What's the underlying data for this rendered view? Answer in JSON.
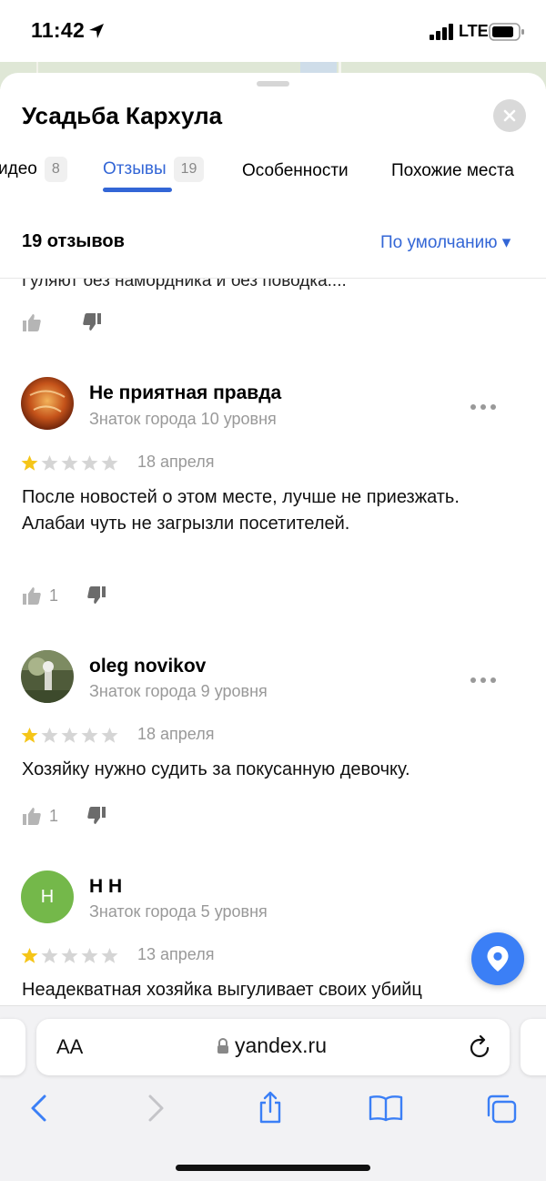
{
  "status_bar": {
    "time": "11:42",
    "network": "LTE"
  },
  "sheet": {
    "title": "Усадьба Кархула",
    "tabs": [
      {
        "label": "идео",
        "count": "8"
      },
      {
        "label": "Отзывы",
        "count": "19",
        "active": true
      },
      {
        "label": "Особенности"
      },
      {
        "label": "Похожие места"
      }
    ],
    "summary": "19 отзывов",
    "sort_label": "По умолчанию ▾",
    "partial_text": "Гуляют без намордника и без поводка...."
  },
  "reviews": [
    {
      "name": "Не приятная правда",
      "level": "Знаток города 10 уровня",
      "rating": 1,
      "date": "18 апреля",
      "text": "После новостей о этом месте, лучше не приезжать. Алабаи чуть не загрызли посетителей.",
      "likes": "1"
    },
    {
      "name": "oleg novikov",
      "level": "Знаток города 9 уровня",
      "rating": 1,
      "date": "18 апреля",
      "text": "Хозяйку нужно судить за покусанную девочку.",
      "likes": "1"
    },
    {
      "name": "Н Н",
      "avatar_letter": "Н",
      "level": "Знаток города 5 уровня",
      "rating": 1,
      "date": "13 апреля",
      "text": "Неадекватная хозяйка выгуливает своих убийц"
    }
  ],
  "browser": {
    "text_size_label": "AA",
    "url": "yandex.ru"
  },
  "colors": {
    "accent": "#3366d6",
    "star_filled": "#f5c518",
    "star_empty": "#d5d5d5",
    "avatar_green": "#74b84a",
    "fab": "#3b7ff6"
  }
}
